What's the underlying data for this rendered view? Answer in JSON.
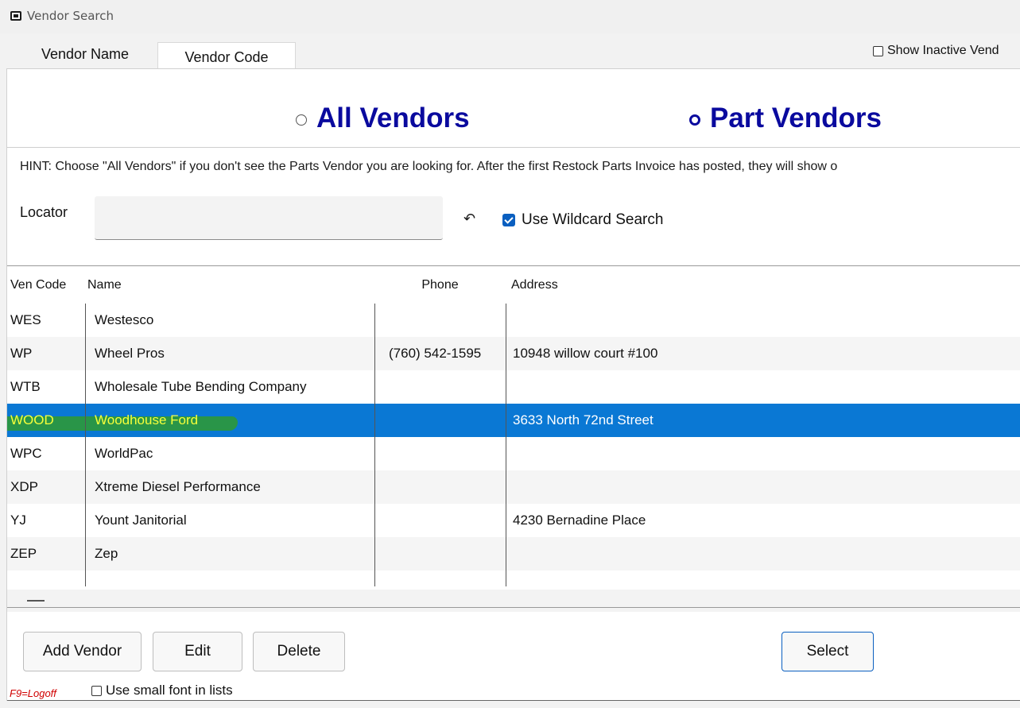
{
  "window": {
    "title": "Vendor Search",
    "icon": "app-icon"
  },
  "tabs": [
    {
      "label": "Vendor Name",
      "active": true
    },
    {
      "label": "Vendor Code",
      "active": false
    }
  ],
  "show_inactive": {
    "label": "Show Inactive Vend",
    "checked": false
  },
  "vendor_filter": {
    "all_label": "All Vendors",
    "part_label": "Part Vendors",
    "selected": "Part Vendors",
    "accent_color": "#0a0a9e"
  },
  "hint": "HINT: Choose \"All Vendors\" if you don't see the Parts Vendor you are looking for.  After the first Restock Parts Invoice has posted, they will show o",
  "locator": {
    "label": "Locator",
    "value": "",
    "undo_icon": "undo-icon"
  },
  "wildcard": {
    "label": "Use Wildcard Search",
    "checked": true
  },
  "grid": {
    "columns": [
      "Ven Code",
      "Name",
      "Phone",
      "Address"
    ],
    "rows": [
      {
        "code": "WES",
        "name": "Westesco",
        "phone": "",
        "address": ""
      },
      {
        "code": "WP",
        "name": "Wheel Pros",
        "phone": "(760) 542-1595",
        "address": "10948 willow court #100"
      },
      {
        "code": "WTB",
        "name": "Wholesale Tube Bending Company",
        "phone": "",
        "address": ""
      },
      {
        "code": "WOOD",
        "name": "Woodhouse Ford",
        "phone": "",
        "address": "3633 North 72nd Street",
        "selected": true
      },
      {
        "code": "WPC",
        "name": "WorldPac",
        "phone": "",
        "address": ""
      },
      {
        "code": "XDP",
        "name": "Xtreme Diesel Performance",
        "phone": "",
        "address": ""
      },
      {
        "code": "YJ",
        "name": "Yount Janitorial",
        "phone": "",
        "address": "4230 Bernadine Place"
      },
      {
        "code": "ZEP",
        "name": "Zep",
        "phone": "",
        "address": ""
      }
    ],
    "selection_color": "#0a78d4"
  },
  "buttons": {
    "add": "Add Vendor",
    "edit": "Edit",
    "delete": "Delete",
    "select": "Select"
  },
  "footer": {
    "f9": "F9=Logoff",
    "small_font_label": "Use small font in lists",
    "small_font_checked": false
  }
}
